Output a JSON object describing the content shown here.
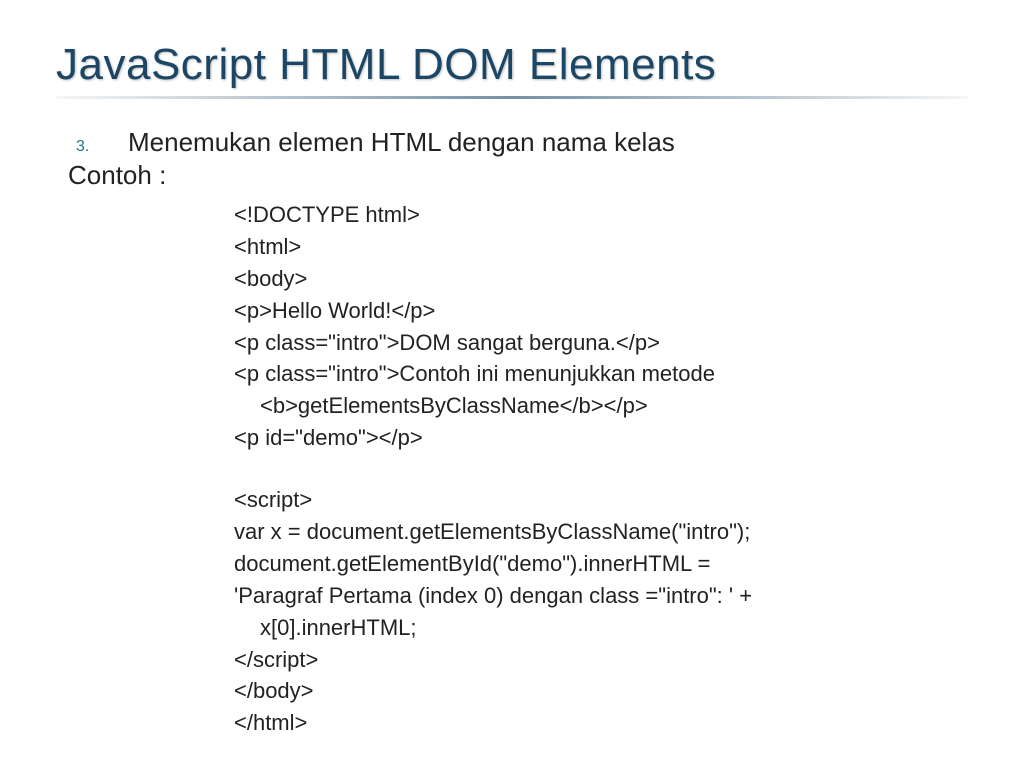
{
  "title": "JavaScript HTML DOM Elements",
  "list": {
    "number": "3.",
    "heading": "Menemukan elemen HTML dengan nama kelas"
  },
  "contoh_label": "Contoh :",
  "code": {
    "l1": "<!DOCTYPE html>",
    "l2": "<html>",
    "l3": "<body>",
    "l4": "<p>Hello World!</p>",
    "l5": "<p class=\"intro\">DOM sangat berguna.</p>",
    "l6": "<p class=\"intro\">Contoh ini menunjukkan metode",
    "l6b": "<b>getElementsByClassName</b></p>",
    "l7": "<p id=\"demo\"></p>",
    "l8": "<script>",
    "l9": "var x = document.getElementsByClassName(\"intro\");",
    "l10": "document.getElementById(\"demo\").innerHTML =",
    "l11": "'Paragraf Pertama (index 0) dengan class =\"intro\": ' +",
    "l11b": "x[0].innerHTML;",
    "l12": "</script>",
    "l13": "</body>",
    "l14": "</html>"
  }
}
